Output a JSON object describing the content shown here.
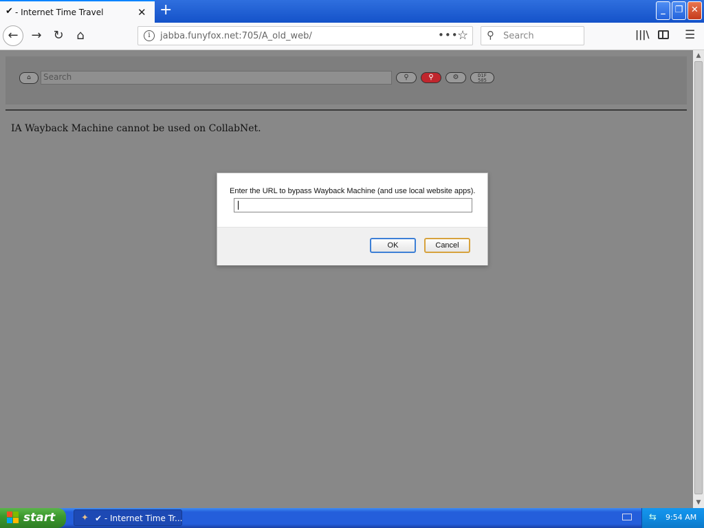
{
  "browser": {
    "tab": {
      "icon": "✔",
      "title": "- Internet Time Travel"
    },
    "new_tab_label": "+",
    "url": "jabba.funyfox.net:705/A_old_web/",
    "search_placeholder": "Search"
  },
  "site": {
    "search_placeholder": "Search",
    "home_icon": "⌂",
    "code_button_lines": [
      "D1F",
      "505"
    ],
    "message": "IA Wayback Machine cannot be used on CollabNet."
  },
  "dialog": {
    "message": "Enter the URL to bypass Wayback Machine (and use local website apps).",
    "input_value": "",
    "ok_label": "OK",
    "cancel_label": "Cancel"
  },
  "taskbar": {
    "start_label": "start",
    "task_label": "✔ - Internet Time Tr...",
    "clock": "9:54 AM"
  },
  "colors": {
    "titlebar": "#1452c9",
    "page_bg": "#888888",
    "go_button": "#c0262d",
    "ok_border": "#3c7fd6",
    "cancel_border": "#d7a23c"
  }
}
